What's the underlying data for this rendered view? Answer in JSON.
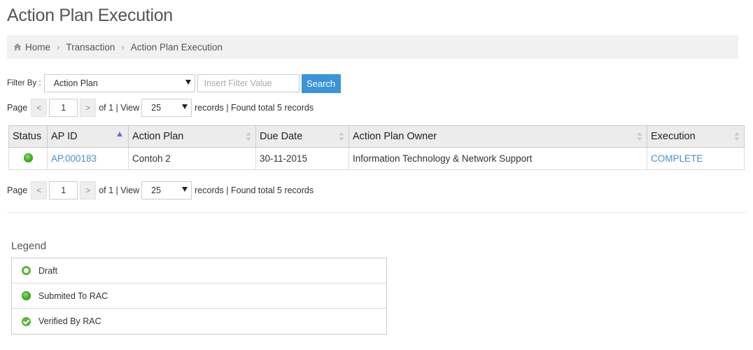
{
  "page": {
    "title": "Action Plan Execution"
  },
  "breadcrumb": {
    "items": [
      "Home",
      "Transaction",
      "Action Plan Execution"
    ],
    "icon": "home-icon"
  },
  "filter": {
    "label": "Filter By :",
    "selected": "Action Plan",
    "placeholder": "Insert Filter Value",
    "value": "",
    "search_label": "Search"
  },
  "pager": {
    "page_label": "Page",
    "prev": "<",
    "next": ">",
    "current_page": "1",
    "of_text": "of 1 | View",
    "page_size": "25",
    "records_text": "records | Found total 5 records"
  },
  "table": {
    "columns": [
      "Status",
      "AP ID",
      "Action Plan",
      "Due Date",
      "Action Plan Owner",
      "Execution"
    ],
    "sorted_column": "AP ID",
    "rows": [
      {
        "status": "submitted",
        "ap_id": "AP.000183",
        "action_plan": "Contoh 2",
        "due_date": "30-11-2015",
        "owner": "Information Technology & Network Support",
        "execution": "COMPLETE"
      }
    ]
  },
  "legend": {
    "title": "Legend",
    "items": [
      {
        "label": "Draft",
        "icon": "hollow-circle-icon"
      },
      {
        "label": "Submited To RAC",
        "icon": "filled-circle-icon"
      },
      {
        "label": "Verified By RAC",
        "icon": "check-circle-icon"
      }
    ]
  },
  "colors": {
    "accent": "#3a95d8",
    "link": "#4a8fc9",
    "status_green": "#3cb024"
  }
}
